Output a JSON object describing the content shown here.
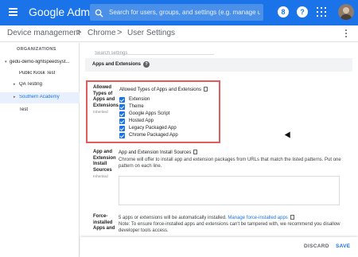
{
  "app": {
    "brand": "Google Admin"
  },
  "topbar": {
    "search_placeholder": "Search for users, groups, and settings (e.g. manage user de",
    "badge_label": "8",
    "help_label": "?"
  },
  "breadcrumb": {
    "items": [
      "Device management",
      "Chrome",
      "User Settings"
    ],
    "separator": ">"
  },
  "sidebar": {
    "title": "ORGANIZATIONS",
    "items": [
      {
        "label": "gedu-demo-lightspeedsyst...",
        "arrow": "▾",
        "selected": false
      },
      {
        "label": "Public Kiosk Test",
        "arrow": "",
        "selected": false
      },
      {
        "label": "QA Testing",
        "arrow": "▸",
        "selected": false
      },
      {
        "label": "Southern Academy",
        "arrow": "▸",
        "selected": true
      },
      {
        "label": "Test",
        "arrow": "",
        "selected": false
      }
    ]
  },
  "main": {
    "search_placeholder": "Search settings",
    "section_title": "Apps and Extensions",
    "allowed_types": {
      "label_lines": [
        "Allowed",
        "Types of",
        "Apps and",
        "Extensions"
      ],
      "inherited": "Inherited",
      "title": "Allowed Types of Apps and Extensions",
      "options": [
        "Extension",
        "Theme",
        "Google Apps Script",
        "Hosted App",
        "Legacy Packaged App",
        "Chrome Packaged App"
      ]
    },
    "install_sources": {
      "label_lines": [
        "App and",
        "Extension",
        "Install",
        "Sources"
      ],
      "inherited": "Inherited",
      "title": "App and Extension Install Sources",
      "desc_lines": [
        "Chrome will offer to install app and extension packages from URLs that match the listed patterns. Put one",
        "pattern on each line."
      ]
    },
    "force_installed": {
      "label_lines": [
        "Force-",
        "installed",
        "Apps and"
      ],
      "line1": "5 apps or extensions will be automatically installed.",
      "link": "Manage force-installed apps",
      "note_lines": [
        "Note: To ensure force-installed apps and extensions can't be tampered with, we recommend you disallow",
        "developer tools access."
      ]
    }
  },
  "footer": {
    "discard": "DISCARD",
    "save": "SAVE"
  },
  "colors": {
    "brand": "#1a73e8",
    "highlight_border": "#e25a5a"
  }
}
